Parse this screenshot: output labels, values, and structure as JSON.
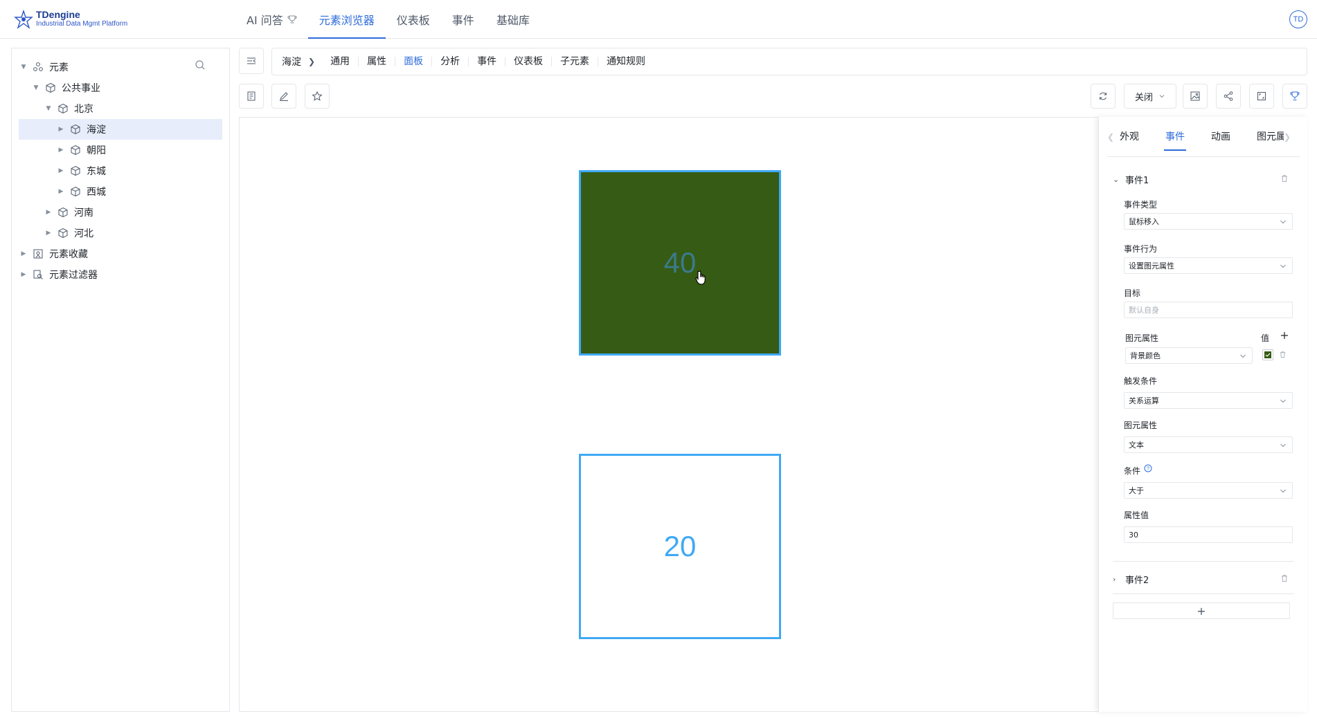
{
  "app": {
    "logo_title": "TDengine",
    "logo_subtitle": "Industrial Data Mgmt Platform",
    "avatar": "TD",
    "accent": "#2d6bdb"
  },
  "nav": [
    "AI 问答",
    "元素浏览器",
    "仪表板",
    "事件",
    "基础库"
  ],
  "nav_active": "元素浏览器",
  "tree": {
    "root": "元素",
    "public": "公共事业",
    "beijing": "北京",
    "haidian": "海淀",
    "chaoyang": "朝阳",
    "dongcheng": "东城",
    "xicheng": "西城",
    "henan": "河南",
    "hebei": "河北",
    "favorites": "元素收藏",
    "filters": "元素过滤器"
  },
  "breadcrumb": {
    "root": "海淀",
    "tabs": [
      "通用",
      "属性",
      "面板",
      "分析",
      "事件",
      "仪表板",
      "子元素",
      "通知规则"
    ],
    "active": "面板"
  },
  "toolbar": {
    "close_select": "关闭"
  },
  "canvas": {
    "shape1_value": "40",
    "shape1_bg": "#365b14",
    "shape2_value": "20",
    "border_color": "#3fa9f5"
  },
  "panel": {
    "tabs": [
      "外观",
      "事件",
      "动画",
      "图元属"
    ],
    "active_tab": "事件",
    "event1": {
      "title": "事件1",
      "type_label": "事件类型",
      "type_value": "鼠标移入",
      "action_label": "事件行为",
      "action_value": "设置图元属性",
      "target_label": "目标",
      "target_placeholder": "默认自身",
      "prop_label": "图元属性",
      "value_label": "值",
      "prop_value": "背景颜色",
      "swatch_color": "#365b14",
      "trigger_label": "触发条件",
      "trigger_value": "关系运算",
      "prop2_label": "图元属性",
      "prop2_value": "文本",
      "cond_label": "条件",
      "cond_value": "大于",
      "attr_value_label": "属性值",
      "attr_value": "30"
    },
    "event2": {
      "title": "事件2"
    },
    "add_label": "+"
  }
}
